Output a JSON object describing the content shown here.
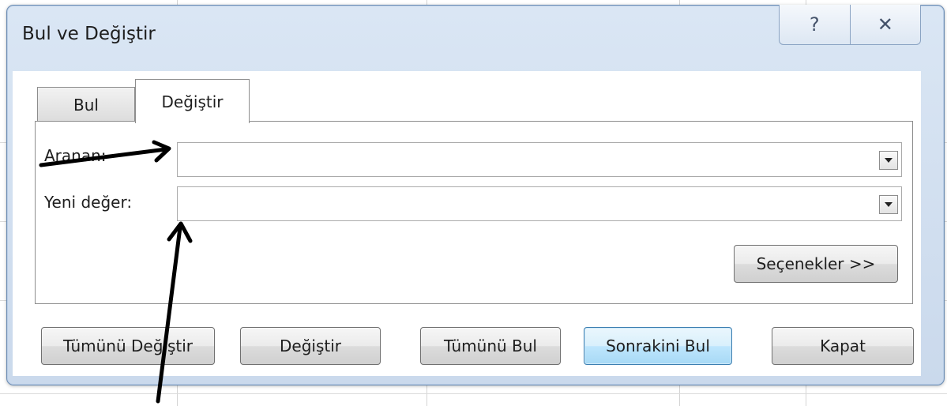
{
  "dialog": {
    "title": "Bul ve Değiştir",
    "help_glyph": "?",
    "close_glyph": "✕"
  },
  "tabs": [
    {
      "label": "Bul",
      "selected": false
    },
    {
      "label": "Değiştir",
      "selected": true
    }
  ],
  "fields": {
    "find": {
      "label": "Aranan:",
      "value": ""
    },
    "replace": {
      "label": "Yeni değer:",
      "value": ""
    }
  },
  "buttons": {
    "options": "Seçenekler >>",
    "replace_all": "Tümünü Değiştir",
    "replace": "Değiştir",
    "find_all": "Tümünü Bul",
    "find_next": "Sonrakini Bul",
    "close": "Kapat"
  },
  "colors": {
    "frame": "#dae6f4",
    "default_button_border": "#3c7fb1",
    "annotation_arrow": "#000000"
  }
}
